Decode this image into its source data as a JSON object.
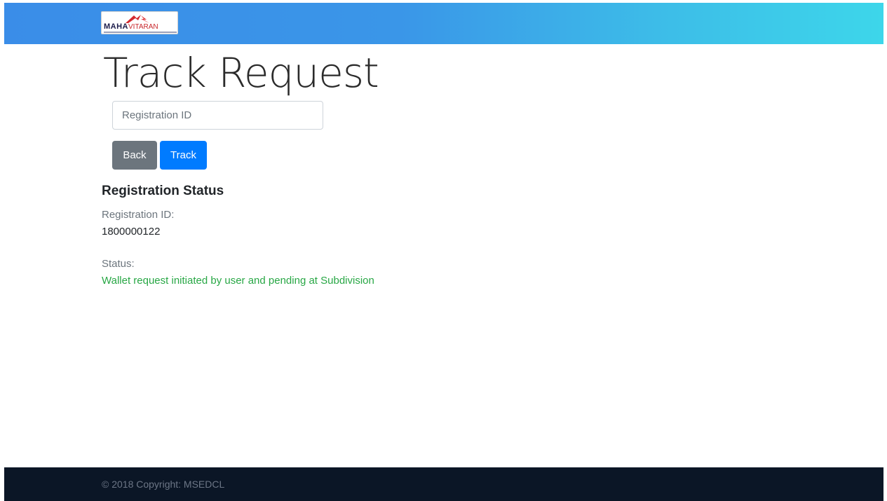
{
  "header": {
    "logo": {
      "brand_main": "MAHA",
      "brand_accent": "VITARAN"
    }
  },
  "main": {
    "title": "Track Request",
    "search": {
      "placeholder": "Registration ID",
      "value": ""
    },
    "buttons": {
      "back_label": "Back",
      "track_label": "Track"
    },
    "result": {
      "heading": "Registration Status",
      "registration_id_label": "Registration ID:",
      "registration_id_value": "1800000122",
      "status_label": "Status:",
      "status_value": "Wallet request initiated by user and pending at Subdivision"
    }
  },
  "footer": {
    "copyright": "© 2018 Copyright: MSEDCL"
  },
  "colors": {
    "header_gradient_start": "#3a8de8",
    "header_gradient_end": "#3dd6ea",
    "back_button": "#6c757d",
    "track_button": "#007bff",
    "status_text": "#28a745",
    "footer_bg": "#0b1626"
  }
}
